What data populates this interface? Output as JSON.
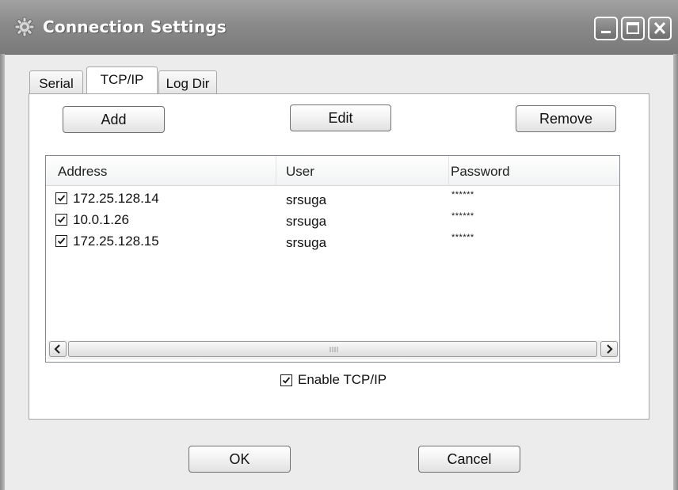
{
  "window": {
    "title": "Connection Settings"
  },
  "tabs": [
    {
      "label": "Serial",
      "active": false
    },
    {
      "label": "TCP/IP",
      "active": true
    },
    {
      "label": "Log Dir",
      "active": false
    }
  ],
  "toolbar": {
    "add_label": "Add",
    "edit_label": "Edit",
    "remove_label": "Remove"
  },
  "table": {
    "columns": [
      "Address",
      "User",
      "Password"
    ],
    "rows": [
      {
        "checked": true,
        "address": "172.25.128.14",
        "user": "srsuga",
        "password": "******"
      },
      {
        "checked": true,
        "address": "10.0.1.26",
        "user": "srsuga",
        "password": "******"
      },
      {
        "checked": true,
        "address": "172.25.128.15",
        "user": "srsuga",
        "password": "******"
      }
    ]
  },
  "enable_tcpip": {
    "label": "Enable TCP/IP",
    "checked": true
  },
  "footer": {
    "ok_label": "OK",
    "cancel_label": "Cancel"
  },
  "colors": {
    "titlebar": "#8a8a8a",
    "window_bg": "#ececec",
    "panel_bg": "#ffffff"
  },
  "icons": [
    "gear-icon",
    "minimize-icon",
    "maximize-icon",
    "close-icon",
    "checkmark-icon",
    "scroll-left-icon",
    "scroll-right-icon",
    "scroll-grip-icon"
  ]
}
